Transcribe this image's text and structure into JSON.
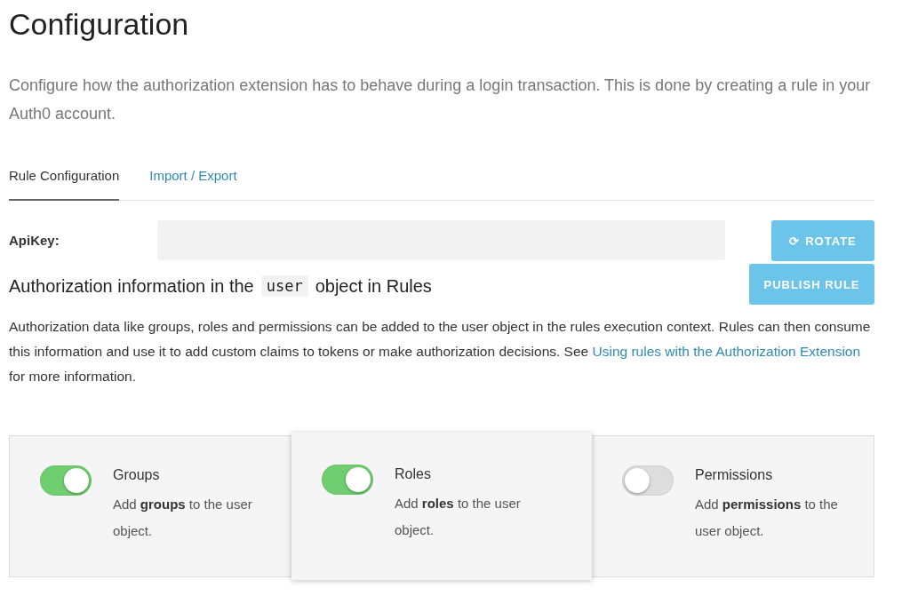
{
  "title": "Configuration",
  "description": "Configure how the authorization extension has to behave during a login transaction. This is done by creating a rule in your Auth0 account.",
  "tabs": [
    {
      "label": "Rule Configuration",
      "selected": true
    },
    {
      "label": "Import / Export",
      "selected": false
    }
  ],
  "apikey": {
    "label": "ApiKey:"
  },
  "rotate_button": {
    "icon": "⟳",
    "label": "ROTATE"
  },
  "publish_button": "PUBLISH RULE",
  "heading": {
    "before": "Authorization information in the",
    "code": "user",
    "after": "object in Rules"
  },
  "paragraph": {
    "before": "Authorization data like groups, roles and permissions can be added to the user object in the rules execution context. Rules can then consume this information and use it to add custom claims to tokens or make authorization decisions. See",
    "link": "Using rules with the Authorization Extension",
    "after": "for more information."
  },
  "options": [
    {
      "title": "Groups",
      "description": "Add **groups** to the user object.",
      "on": true,
      "selected": false
    },
    {
      "title": "Roles",
      "description": "Add **roles** to the user object.",
      "on": true,
      "selected": true
    },
    {
      "title": "Permissions",
      "description": "Add **permissions** to the user object.",
      "on": false,
      "selected": false
    }
  ]
}
